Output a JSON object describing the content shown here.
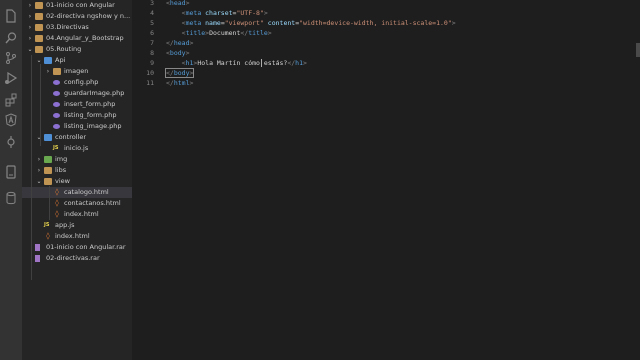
{
  "activity_bar": {
    "icons": [
      "explorer-icon",
      "search-icon",
      "source-control-icon",
      "run-debug-icon",
      "extensions-icon",
      "angular-icon",
      "git-lens-icon",
      "remote-explorer-icon",
      "database-icon"
    ]
  },
  "explorer": {
    "items": [
      {
        "label": "01-inicio con Angular",
        "type": "folder",
        "depth": 1,
        "expanded": false
      },
      {
        "label": "02-directiva ngshow y n...",
        "type": "folder",
        "depth": 1,
        "expanded": false
      },
      {
        "label": "03.Directivas",
        "type": "folder",
        "depth": 1,
        "expanded": false
      },
      {
        "label": "04.Angular_y_Bootstrap",
        "type": "folder",
        "depth": 1,
        "expanded": false
      },
      {
        "label": "05.Routing",
        "type": "folder",
        "depth": 1,
        "expanded": true
      },
      {
        "label": "Api",
        "type": "folder-blue",
        "depth": 2,
        "expanded": true
      },
      {
        "label": "imagen",
        "type": "folder",
        "depth": 3,
        "expanded": false
      },
      {
        "label": "config.php",
        "type": "php",
        "depth": 3
      },
      {
        "label": "guardarImage.php",
        "type": "php",
        "depth": 3
      },
      {
        "label": "insert_form.php",
        "type": "php",
        "depth": 3
      },
      {
        "label": "listing_form.php",
        "type": "php",
        "depth": 3
      },
      {
        "label": "listing_image.php",
        "type": "php",
        "depth": 3
      },
      {
        "label": "controller",
        "type": "folder-blue",
        "depth": 2,
        "expanded": true
      },
      {
        "label": "inicio.js",
        "type": "js",
        "depth": 3
      },
      {
        "label": "img",
        "type": "folder-green",
        "depth": 2,
        "expanded": false
      },
      {
        "label": "libs",
        "type": "folder",
        "depth": 2,
        "expanded": false
      },
      {
        "label": "view",
        "type": "folder",
        "depth": 2,
        "expanded": true
      },
      {
        "label": "catalogo.html",
        "type": "html",
        "depth": 3,
        "active": true
      },
      {
        "label": "contactanos.html",
        "type": "html",
        "depth": 3
      },
      {
        "label": "index.html",
        "type": "html",
        "depth": 3
      },
      {
        "label": "app.js",
        "type": "js",
        "depth": 2
      },
      {
        "label": "index.html",
        "type": "html",
        "depth": 2
      },
      {
        "label": "01-inicio con Angular.rar",
        "type": "rar",
        "depth": 1
      },
      {
        "label": "02-directivas.rar",
        "type": "rar",
        "depth": 1
      }
    ]
  },
  "editor": {
    "line_numbers": [
      "3",
      "4",
      "5",
      "6",
      "7",
      "8",
      "9",
      "10",
      "11"
    ],
    "lines": [
      [
        {
          "t": "<",
          "c": "br"
        },
        {
          "t": "head",
          "c": "tag"
        },
        {
          "t": ">",
          "c": "br"
        }
      ],
      [
        {
          "t": "    ",
          "c": "txt"
        },
        {
          "t": "<",
          "c": "br"
        },
        {
          "t": "meta",
          "c": "tag"
        },
        {
          "t": " charset",
          "c": "att"
        },
        {
          "t": "=",
          "c": "txt"
        },
        {
          "t": "\"UTF-8\"",
          "c": "str"
        },
        {
          "t": ">",
          "c": "br"
        }
      ],
      [
        {
          "t": "    ",
          "c": "txt"
        },
        {
          "t": "<",
          "c": "br"
        },
        {
          "t": "meta",
          "c": "tag"
        },
        {
          "t": " name",
          "c": "att"
        },
        {
          "t": "=",
          "c": "txt"
        },
        {
          "t": "\"viewport\"",
          "c": "str"
        },
        {
          "t": " content",
          "c": "att"
        },
        {
          "t": "=",
          "c": "txt"
        },
        {
          "t": "\"width=device-width, initial-scale=1.0\"",
          "c": "str"
        },
        {
          "t": ">",
          "c": "br"
        }
      ],
      [
        {
          "t": "    ",
          "c": "txt"
        },
        {
          "t": "<",
          "c": "br"
        },
        {
          "t": "title",
          "c": "tag"
        },
        {
          "t": ">",
          "c": "br"
        },
        {
          "t": "Document",
          "c": "txt"
        },
        {
          "t": "</",
          "c": "br"
        },
        {
          "t": "title",
          "c": "tag"
        },
        {
          "t": ">",
          "c": "br"
        }
      ],
      [
        {
          "t": "</",
          "c": "br"
        },
        {
          "t": "head",
          "c": "tag"
        },
        {
          "t": ">",
          "c": "br"
        }
      ],
      [
        {
          "t": "<",
          "c": "br"
        },
        {
          "t": "body",
          "c": "tag"
        },
        {
          "t": ">",
          "c": "br"
        }
      ],
      [
        {
          "t": "    ",
          "c": "txt"
        },
        {
          "t": "<",
          "c": "br"
        },
        {
          "t": "h1",
          "c": "tag"
        },
        {
          "t": ">",
          "c": "br"
        },
        {
          "t": "Hola Martín cómo estás?",
          "c": "txt"
        },
        {
          "t": "</",
          "c": "br"
        },
        {
          "t": "h1",
          "c": "tag"
        },
        {
          "t": ">",
          "c": "br"
        }
      ],
      [
        {
          "t": "</",
          "c": "br"
        },
        {
          "t": "body",
          "c": "tag"
        },
        {
          "t": ">",
          "c": "br"
        }
      ],
      [
        {
          "t": "</",
          "c": "br"
        },
        {
          "t": "html",
          "c": "tag"
        },
        {
          "t": ">",
          "c": "br"
        }
      ]
    ],
    "colors": {
      "tag": "#569cd6",
      "bracket": "#808080",
      "attribute": "#9cdcfe",
      "string": "#ce9178",
      "text": "#d4d4d4"
    }
  }
}
